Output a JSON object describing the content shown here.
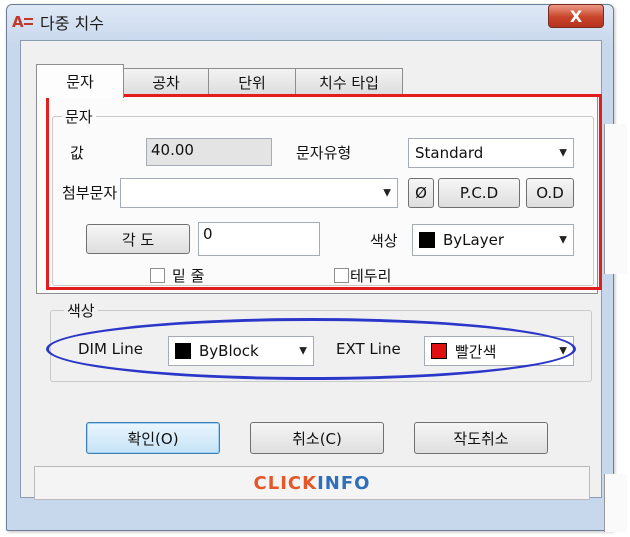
{
  "window": {
    "title": "다중 치수",
    "close_label": "X"
  },
  "tabs": [
    {
      "label": "문자",
      "active": true
    },
    {
      "label": "공차",
      "active": false
    },
    {
      "label": "단위",
      "active": false
    },
    {
      "label": "치수 타입",
      "active": false
    }
  ],
  "text_group": {
    "legend": "문자",
    "value_label": "값",
    "value": "40.00",
    "style_label": "문자유형",
    "style_value": "Standard",
    "suffix_label": "첨부문자",
    "suffix_value": "",
    "diameter_button": "Ø",
    "pcd_button": "P.C.D",
    "od_button": "O.D",
    "angle_button": "각 도",
    "angle_value": "0",
    "color_label": "색상",
    "color_value": "ByLayer",
    "color_swatch": "#000000",
    "underline_label": "밑 줄",
    "border_label": "테두리"
  },
  "color_group": {
    "legend": "색상",
    "dim_line_label": "DIM Line",
    "dim_line_value": "ByBlock",
    "dim_line_swatch": "#000000",
    "ext_line_label": "EXT Line",
    "ext_line_value": "빨간색",
    "ext_line_swatch": "#e01010"
  },
  "buttons": {
    "ok": "확인(O)",
    "cancel": "취소(C)",
    "cancel_drawing": "작도취소"
  },
  "footer": {
    "logo_part1": "CLICK",
    "logo_part2": "INFO"
  },
  "annotation_colors": {
    "red_box": "#e31d1d",
    "blue_ellipse": "#2a37c8"
  }
}
